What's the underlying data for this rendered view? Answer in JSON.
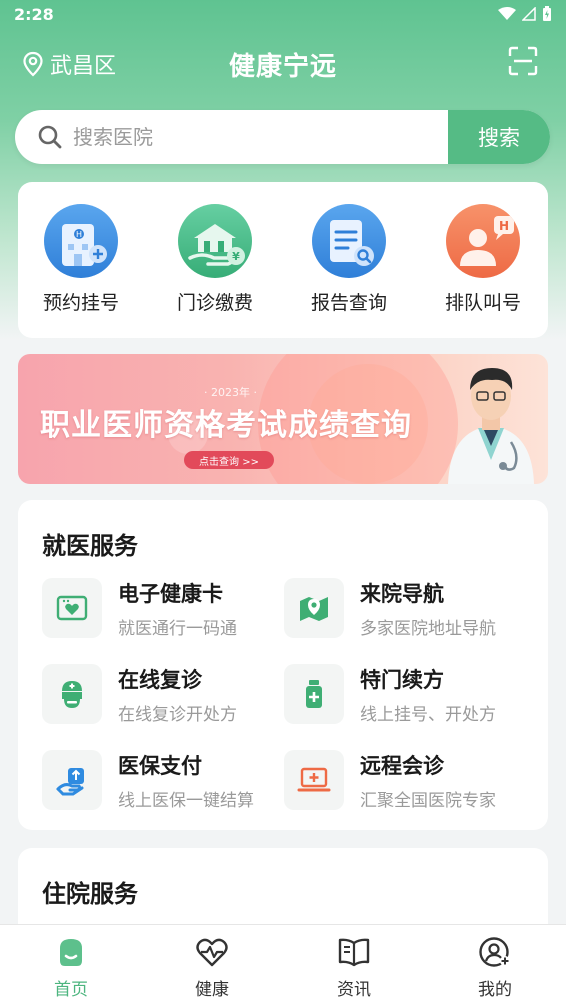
{
  "status_bar": {
    "time": "2:28"
  },
  "header": {
    "location": "武昌区",
    "title": "健康宁远"
  },
  "search": {
    "placeholder": "搜索医院",
    "button_label": "搜索"
  },
  "quick_actions": [
    {
      "label": "预约挂号",
      "icon": "hospital-building-icon"
    },
    {
      "label": "门诊缴费",
      "icon": "payment-hand-icon"
    },
    {
      "label": "报告查询",
      "icon": "report-search-icon"
    },
    {
      "label": "排队叫号",
      "icon": "queue-call-icon"
    }
  ],
  "banner": {
    "year": "· 2023年 ·",
    "title": "职业医师资格考试成绩查询",
    "button": "点击查询 >>"
  },
  "medical_services": {
    "title": "就医服务",
    "items": [
      {
        "title": "电子健康卡",
        "subtitle": "就医通行一码通",
        "icon": "health-card-icon"
      },
      {
        "title": "来院导航",
        "subtitle": "多家医院地址导航",
        "icon": "map-navigation-icon"
      },
      {
        "title": "在线复诊",
        "subtitle": "在线复诊开处方",
        "icon": "nurse-icon"
      },
      {
        "title": "特门续方",
        "subtitle": "线上挂号、开处方",
        "icon": "medicine-bottle-icon"
      },
      {
        "title": "医保支付",
        "subtitle": "线上医保一键结算",
        "icon": "insurance-pay-icon"
      },
      {
        "title": "远程会诊",
        "subtitle": "汇聚全国医院专家",
        "icon": "remote-consult-icon"
      }
    ]
  },
  "inpatient_services": {
    "title": "住院服务"
  },
  "tabbar": {
    "items": [
      {
        "label": "首页",
        "icon": "home-icon",
        "active": true
      },
      {
        "label": "健康",
        "icon": "heart-pulse-icon",
        "active": false
      },
      {
        "label": "资讯",
        "icon": "book-icon",
        "active": false
      },
      {
        "label": "我的",
        "icon": "user-icon",
        "active": false
      }
    ]
  },
  "colors": {
    "accent": "#55bb85",
    "tab_active": "#4db57f",
    "banner_button": "#e24a5a"
  }
}
